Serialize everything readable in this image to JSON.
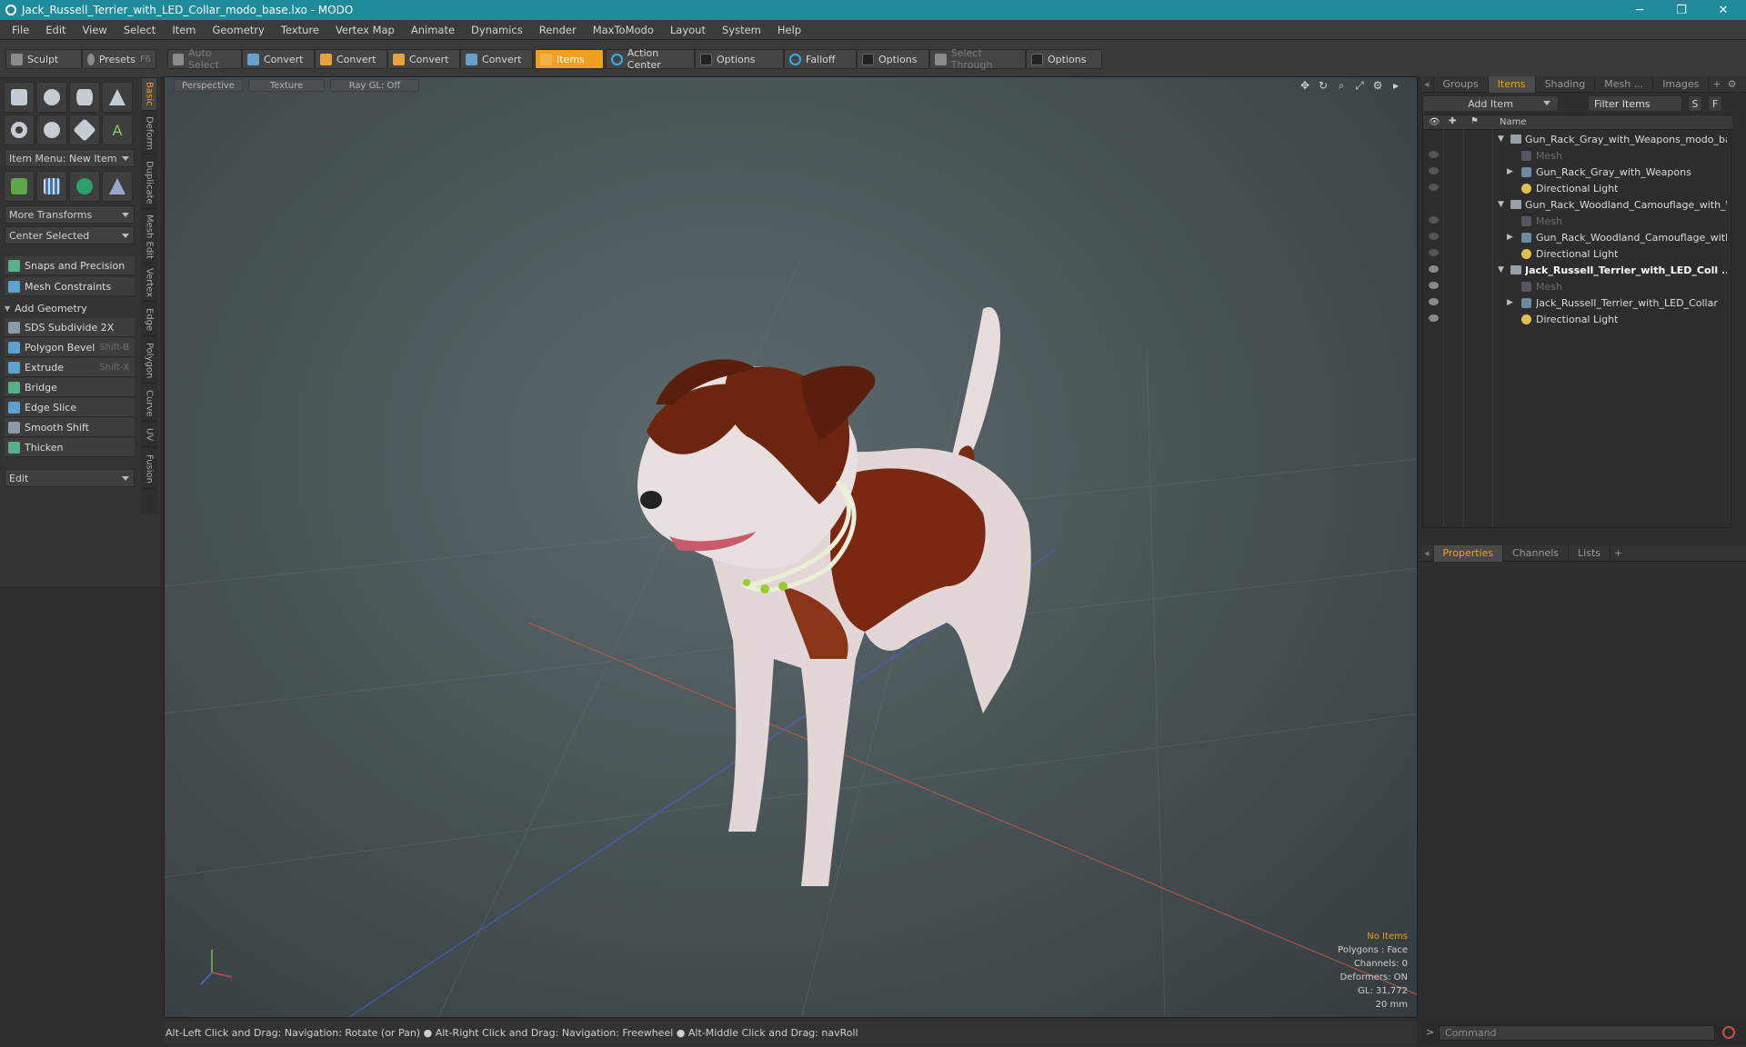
{
  "window": {
    "title": "Jack_Russell_Terrier_with_LED_Collar_modo_base.lxo - MODO",
    "minimize": "─",
    "maximize": "❐",
    "close": "✕"
  },
  "menu": [
    "File",
    "Edit",
    "View",
    "Select",
    "Item",
    "Geometry",
    "Texture",
    "Vertex Map",
    "Animate",
    "Dynamics",
    "Render",
    "MaxToModo",
    "Layout",
    "System",
    "Help"
  ],
  "toolbar": {
    "sculpt": "Sculpt",
    "presets": "Presets",
    "presets_key": "F6",
    "auto_select": "Auto Select",
    "convert1": "Convert",
    "convert2": "Convert",
    "convert3": "Convert",
    "convert4": "Convert",
    "items": "Items",
    "action_center": "Action Center",
    "options1": "Options",
    "falloff": "Falloff",
    "options2": "Options",
    "select_through": "Select Through",
    "options3": "Options"
  },
  "left": {
    "item_menu": "Item Menu: New Item",
    "more_transforms": "More Transforms",
    "center_selected": "Center Selected",
    "snaps": "Snaps and Precision",
    "mesh_constraints": "Mesh Constraints",
    "add_geometry": "Add Geometry",
    "tools": [
      {
        "label": "SDS Subdivide 2X",
        "key": ""
      },
      {
        "label": "Polygon Bevel",
        "key": "Shift-B"
      },
      {
        "label": "Extrude",
        "key": "Shift-X"
      },
      {
        "label": "Bridge",
        "key": ""
      },
      {
        "label": "Edge Slice",
        "key": ""
      },
      {
        "label": "Smooth Shift",
        "key": ""
      },
      {
        "label": "Thicken",
        "key": ""
      }
    ],
    "edit": "Edit",
    "vtabs": [
      "Basic",
      "Deform",
      "Duplicate",
      "Mesh Edit",
      "Vertex",
      "Edge",
      "Polygon",
      "Curve",
      "UV",
      "Fusion"
    ]
  },
  "viewport": {
    "view": "Perspective",
    "shading": "Texture",
    "raygl": "Ray GL: Off",
    "stats": {
      "selection": "No Items",
      "polygons": "Polygons : Face",
      "channels": "Channels: 0",
      "deformers": "Deformers: ON",
      "gl": "GL: 31,772",
      "scale": "20 mm"
    }
  },
  "status": "Alt-Left Click and Drag: Navigation: Rotate (or Pan) ● Alt-Right Click and Drag: Navigation: Freewheel ● Alt-Middle Click and Drag: navRoll",
  "right": {
    "tabs": [
      "Groups",
      "Items",
      "Shading",
      "Mesh ...",
      "Images"
    ],
    "add_item": "Add Item",
    "filter": "Filter Items",
    "s_btn": "S",
    "f_btn": "F",
    "name_col": "Name",
    "tree": [
      {
        "name": "Gun_Rack_Gray_with_Weapons_modo_ba ...",
        "kind": "group",
        "level": 0
      },
      {
        "name": "Mesh",
        "kind": "mesh",
        "level": 1
      },
      {
        "name": "Gun_Rack_Gray_with_Weapons",
        "kind": "mesh2",
        "level": 1
      },
      {
        "name": "Directional Light",
        "kind": "light",
        "level": 1
      },
      {
        "name": "Gun_Rack_Woodland_Camouflage_with_W...",
        "kind": "group",
        "level": 0
      },
      {
        "name": "Mesh",
        "kind": "mesh",
        "level": 1
      },
      {
        "name": "Gun_Rack_Woodland_Camouflage_with ...",
        "kind": "mesh2",
        "level": 1
      },
      {
        "name": "Directional Light",
        "kind": "light",
        "level": 1
      },
      {
        "name": "Jack_Russell_Terrier_with_LED_Coll ...",
        "kind": "group",
        "level": 0
      },
      {
        "name": "Mesh",
        "kind": "mesh",
        "level": 1
      },
      {
        "name": "Jack_Russell_Terrier_with_LED_Collar",
        "kind": "mesh2",
        "level": 1
      },
      {
        "name": "Directional Light",
        "kind": "light",
        "level": 1
      }
    ],
    "ptabs": [
      "Properties",
      "Channels",
      "Lists"
    ],
    "command": "Command"
  },
  "colors": {
    "accent": "#f0a020",
    "title": "#1f8a99"
  }
}
